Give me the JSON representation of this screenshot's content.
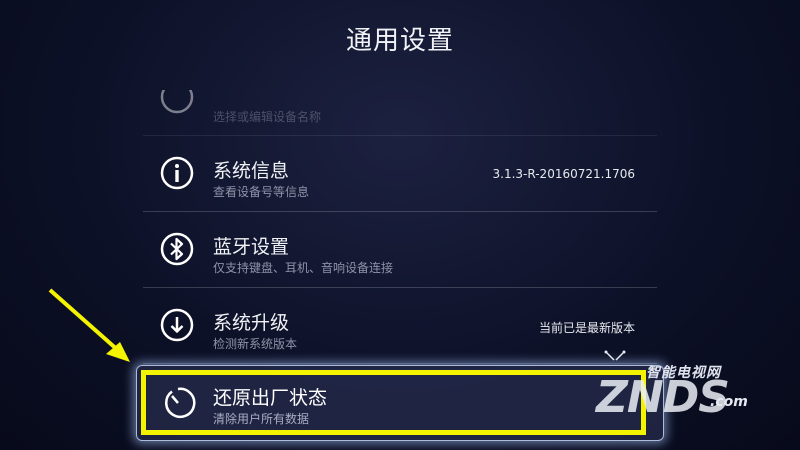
{
  "header": {
    "title": "通用设置"
  },
  "list": {
    "partial_item": {
      "subtitle": "选择或编辑设备名称",
      "icon": "device-name-icon"
    },
    "items": [
      {
        "title": "系统信息",
        "subtitle": "查看设备号等信息",
        "value": "3.1.3-R-20160721.1706",
        "icon": "info-icon"
      },
      {
        "title": "蓝牙设置",
        "subtitle": "仅支持键盘、耳机、音响设备连接",
        "value": "",
        "icon": "bluetooth-icon"
      },
      {
        "title": "系统升级",
        "subtitle": "检测新系统版本",
        "value": "当前已是最新版本",
        "icon": "download-icon"
      }
    ],
    "selected_item": {
      "title": "还原出厂状态",
      "subtitle": "清除用户所有数据",
      "icon": "reset-icon"
    }
  },
  "annotation": {
    "arrow_color": "#f4f400",
    "highlight_color": "#f4f400"
  },
  "watermark": {
    "top": "智能电视网",
    "main": "ZNDS",
    "domain": ".com"
  }
}
